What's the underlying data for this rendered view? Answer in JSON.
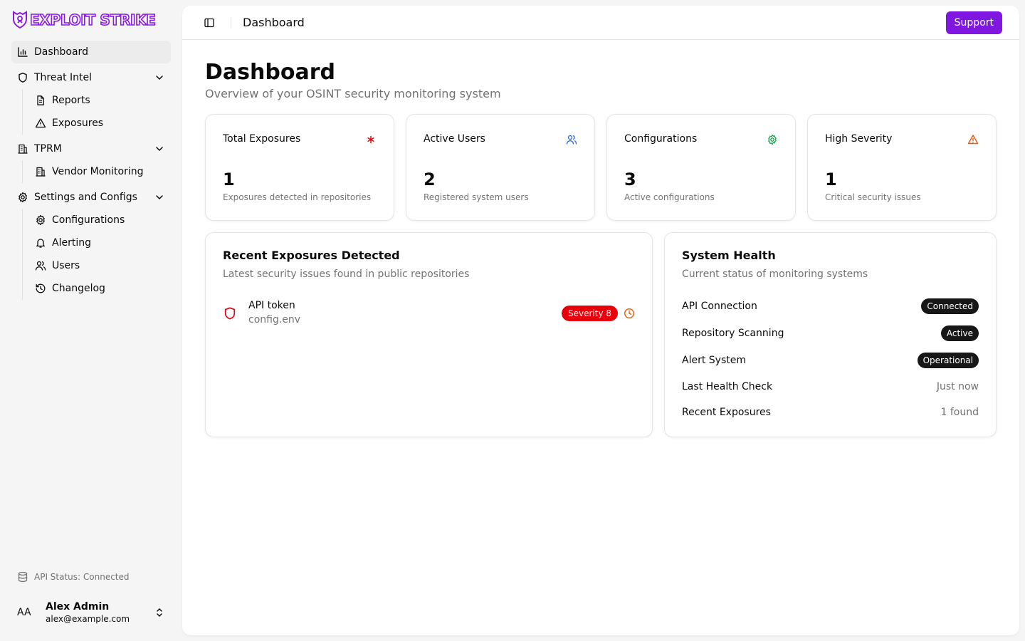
{
  "brand": {
    "name": "EXPLOIT STRIKE",
    "color": "#8b1ae0"
  },
  "sidebar": {
    "items": [
      {
        "label": "Dashboard",
        "icon": "bar-chart-icon",
        "active": true
      },
      {
        "label": "Threat Intel",
        "icon": "shield-icon",
        "expanded": true,
        "children": [
          {
            "label": "Reports",
            "icon": "file-text-icon"
          },
          {
            "label": "Exposures",
            "icon": "warning-triangle-icon"
          }
        ]
      },
      {
        "label": "TPRM",
        "icon": "building-icon",
        "expanded": true,
        "children": [
          {
            "label": "Vendor Monitoring",
            "icon": "building-icon"
          }
        ]
      },
      {
        "label": "Settings and Configs",
        "icon": "gear-icon",
        "expanded": true,
        "children": [
          {
            "label": "Configurations",
            "icon": "gear-icon"
          },
          {
            "label": "Alerting",
            "icon": "bell-icon"
          },
          {
            "label": "Users",
            "icon": "users-icon"
          },
          {
            "label": "Changelog",
            "icon": "history-icon"
          }
        ]
      }
    ],
    "api_status": "API Status: Connected",
    "user": {
      "initials": "AA",
      "name": "Alex Admin",
      "email": "alex@example.com"
    }
  },
  "header": {
    "breadcrumb": "Dashboard",
    "support_label": "Support",
    "support_color": "#8017e0"
  },
  "page": {
    "title": "Dashboard",
    "subtitle": "Overview of your OSINT security monitoring system"
  },
  "stats": [
    {
      "title": "Total Exposures",
      "value": "1",
      "desc": "Exposures detected in repositories",
      "icon": "asterisk-icon",
      "color": "#e7000b"
    },
    {
      "title": "Active Users",
      "value": "2",
      "desc": "Registered system users",
      "icon": "users-icon",
      "color": "#2563eb"
    },
    {
      "title": "Configurations",
      "value": "3",
      "desc": "Active configurations",
      "icon": "gear-icon",
      "color": "#16a34a"
    },
    {
      "title": "High Severity",
      "value": "1",
      "desc": "Critical security issues",
      "icon": "warning-triangle-icon",
      "color": "#ea580c"
    }
  ],
  "recent": {
    "title": "Recent Exposures Detected",
    "subtitle": "Latest security issues found in public repositories",
    "items": [
      {
        "name": "API token",
        "file": "config.env",
        "severity": "Severity 8"
      }
    ]
  },
  "health": {
    "title": "System Health",
    "subtitle": "Current status of monitoring systems",
    "rows": [
      {
        "label": "API Connection",
        "value": "Connected",
        "pill": true
      },
      {
        "label": "Repository Scanning",
        "value": "Active",
        "pill": true
      },
      {
        "label": "Alert System",
        "value": "Operational",
        "pill": true
      },
      {
        "label": "Last Health Check",
        "value": "Just now",
        "pill": false
      },
      {
        "label": "Recent Exposures",
        "value": "1 found",
        "pill": false
      }
    ]
  }
}
